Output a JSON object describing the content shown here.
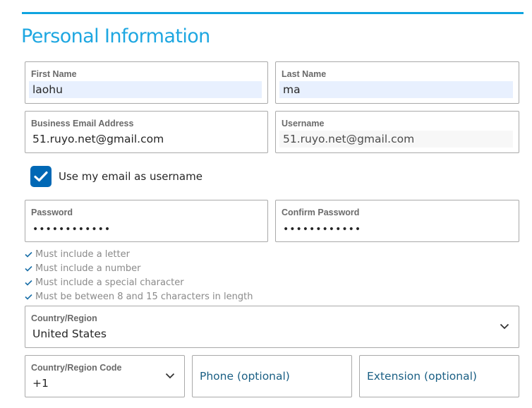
{
  "section": {
    "title": "Personal Information"
  },
  "first_name": {
    "label": "First Name",
    "value": "laohu"
  },
  "last_name": {
    "label": "Last Name",
    "value": "ma"
  },
  "email": {
    "label": "Business Email Address",
    "value": "51.ruyo.net@gmail.com"
  },
  "username": {
    "label": "Username",
    "value": "51.ruyo.net@gmail.com"
  },
  "use_email_checkbox": {
    "label": "Use my email as username",
    "checked": true
  },
  "password": {
    "label": "Password",
    "value": "••••••••••••"
  },
  "confirm_password": {
    "label": "Confirm Password",
    "value": "••••••••••••"
  },
  "password_rules": [
    "Must include a letter",
    "Must include a number",
    "Must include a special character",
    "Must be between 8 and 15 characters in length"
  ],
  "country": {
    "label": "Country/Region",
    "value": "United States"
  },
  "country_code": {
    "label": "Country/Region Code",
    "value": "+1"
  },
  "phone": {
    "placeholder": "Phone (optional)"
  },
  "extension": {
    "placeholder": "Extension (optional)"
  },
  "colors": {
    "accent": "#1ea7e1",
    "checkbox": "#0068b5",
    "rule_check": "#1a6fa8",
    "autofill_bg": "#e8f0fe"
  }
}
